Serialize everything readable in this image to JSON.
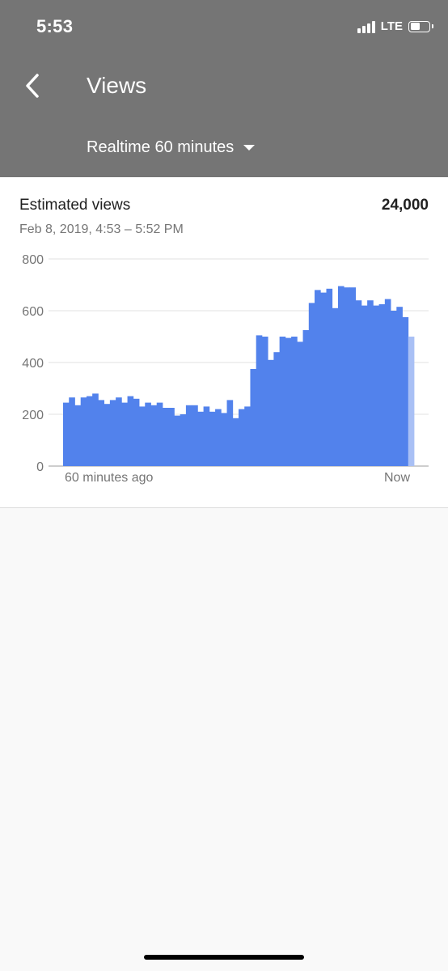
{
  "status_bar": {
    "time": "5:53",
    "network": "LTE"
  },
  "header": {
    "title": "Views",
    "period": "Realtime 60 minutes"
  },
  "card": {
    "metric_label": "Estimated views",
    "metric_value": "24,000",
    "date_range": "Feb 8, 2019, 4:53 – 5:52 PM"
  },
  "colors": {
    "bar": "#5282ec",
    "bar_partial": "#a9c0f5",
    "header": "#757575"
  },
  "chart_data": {
    "type": "bar",
    "ylim": [
      0,
      800
    ],
    "yticks": [
      "0",
      "200",
      "400",
      "600",
      "800"
    ],
    "x_start_label": "60 minutes ago",
    "x_end_label": "Now",
    "grid": true,
    "values": [
      245,
      265,
      235,
      265,
      270,
      280,
      255,
      240,
      255,
      265,
      245,
      270,
      260,
      230,
      245,
      235,
      245,
      225,
      225,
      195,
      200,
      235,
      235,
      210,
      230,
      210,
      220,
      205,
      255,
      185,
      220,
      230,
      375,
      505,
      500,
      410,
      440,
      500,
      495,
      500,
      480,
      525,
      630,
      680,
      670,
      685,
      610,
      695,
      690,
      690,
      640,
      620,
      640,
      620,
      625,
      645,
      600,
      615,
      575,
      500
    ],
    "partial_last": true
  }
}
